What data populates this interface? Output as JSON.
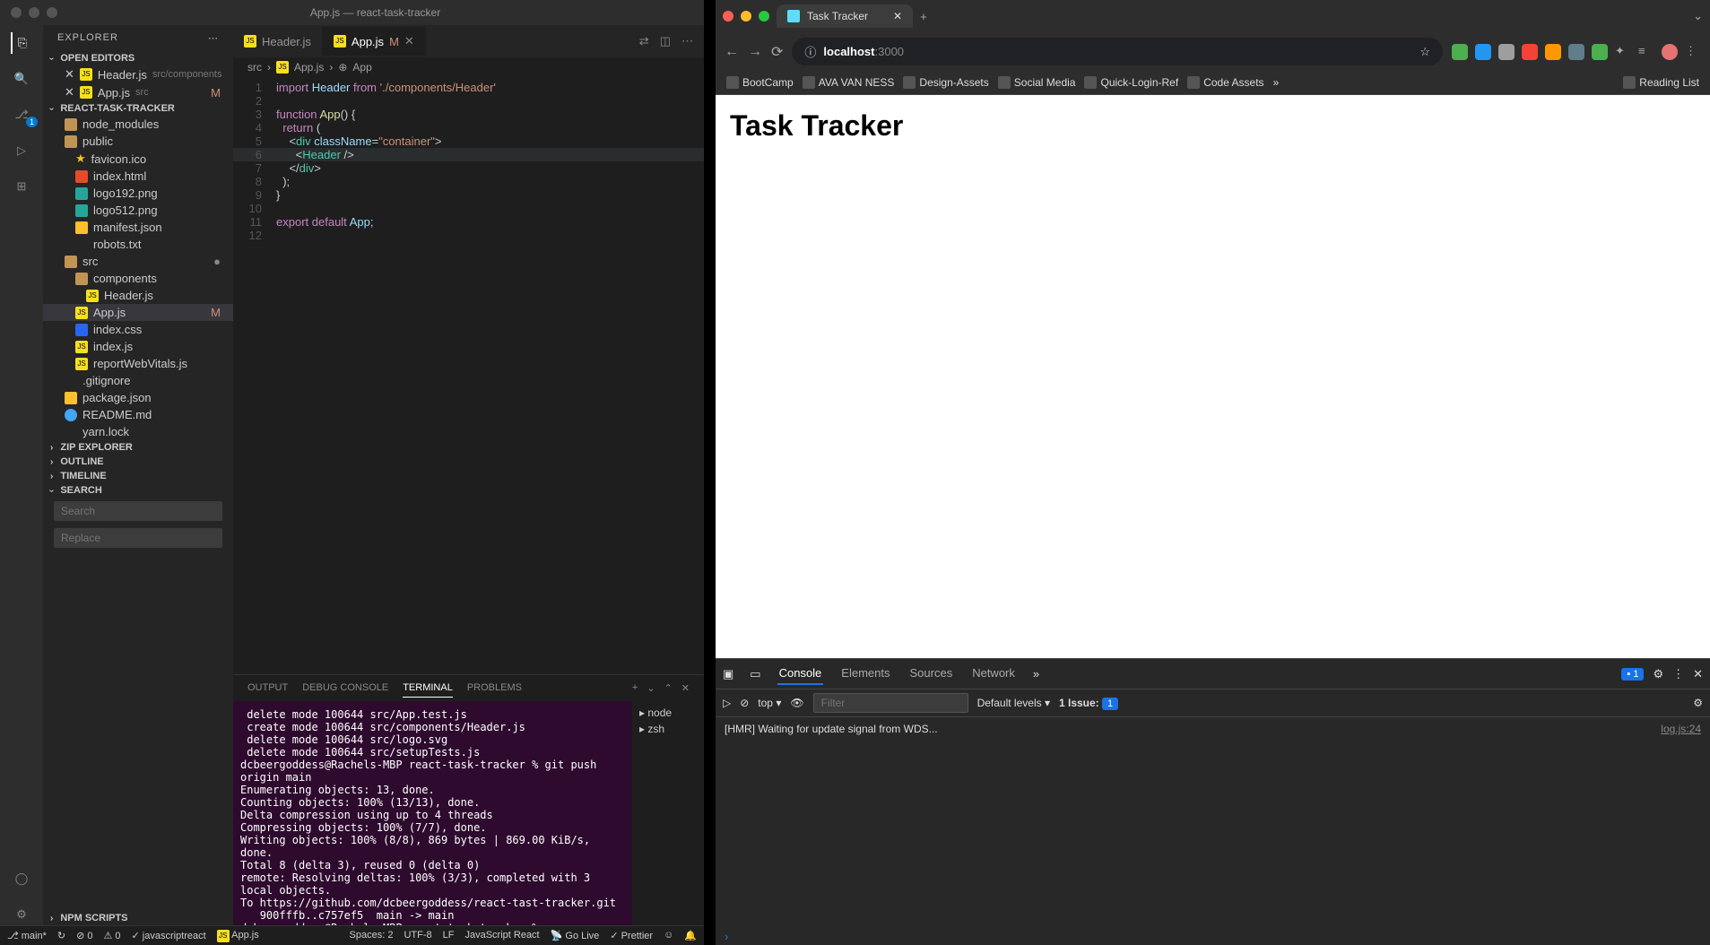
{
  "vscode": {
    "title": "App.js — react-task-tracker",
    "explorer": {
      "title": "EXPLORER",
      "openEditors": "OPEN EDITORS",
      "project": "REACT-TASK-TRACKER",
      "zipExplorer": "ZIP EXPLORER",
      "outline": "OUTLINE",
      "timeline": "TIMELINE",
      "search": "SEARCH",
      "npmScripts": "NPM SCRIPTS",
      "searchPlaceholder": "Search",
      "replacePlaceholder": "Replace",
      "openFiles": [
        {
          "name": "Header.js",
          "path": "src/components"
        },
        {
          "name": "App.js",
          "path": "src",
          "modified": "M"
        }
      ],
      "tree": [
        {
          "name": "node_modules",
          "icon": "folder"
        },
        {
          "name": "public",
          "icon": "folder"
        },
        {
          "name": "favicon.ico",
          "icon": "star",
          "indent": 1
        },
        {
          "name": "index.html",
          "icon": "html",
          "indent": 1
        },
        {
          "name": "logo192.png",
          "icon": "img",
          "indent": 1
        },
        {
          "name": "logo512.png",
          "icon": "img",
          "indent": 1
        },
        {
          "name": "manifest.json",
          "icon": "json",
          "indent": 1
        },
        {
          "name": "robots.txt",
          "icon": "txt",
          "indent": 1
        },
        {
          "name": "src",
          "icon": "folder",
          "dot": true
        },
        {
          "name": "components",
          "icon": "folder",
          "indent": 1
        },
        {
          "name": "Header.js",
          "icon": "js",
          "indent": 2
        },
        {
          "name": "App.js",
          "icon": "js",
          "indent": 1,
          "modified": "M",
          "active": true
        },
        {
          "name": "index.css",
          "icon": "css",
          "indent": 1
        },
        {
          "name": "index.js",
          "icon": "js",
          "indent": 1
        },
        {
          "name": "reportWebVitals.js",
          "icon": "js",
          "indent": 1
        },
        {
          "name": ".gitignore",
          "icon": "git"
        },
        {
          "name": "package.json",
          "icon": "json"
        },
        {
          "name": "README.md",
          "icon": "md"
        },
        {
          "name": "yarn.lock",
          "icon": "lock"
        }
      ]
    },
    "tabs": [
      {
        "name": "Header.js",
        "active": false
      },
      {
        "name": "App.js",
        "active": true,
        "modified": "M"
      }
    ],
    "breadcrumb": [
      "src",
      "App.js",
      "App"
    ],
    "code": {
      "lines": [
        {
          "n": 1,
          "html": "<span class='kw'>import</span> <span class='attr'>Header</span> <span class='kw'>from</span> <span class='str'>'./components/Header'</span>"
        },
        {
          "n": 2,
          "html": ""
        },
        {
          "n": 3,
          "html": "<span class='kw'>function</span> <span class='fn'>App</span>() {"
        },
        {
          "n": 4,
          "html": "  <span class='kw'>return</span> ("
        },
        {
          "n": 5,
          "html": "    &lt;<span class='tag'>div</span> <span class='attr'>className</span>=<span class='str'>\"container\"</span>&gt;"
        },
        {
          "n": 6,
          "html": "      &lt;<span class='cls'>Header</span> /&gt;",
          "current": true
        },
        {
          "n": 7,
          "html": "    &lt;/<span class='tag'>div</span>&gt;"
        },
        {
          "n": 8,
          "html": "  );"
        },
        {
          "n": 9,
          "html": "}"
        },
        {
          "n": 10,
          "html": ""
        },
        {
          "n": 11,
          "html": "<span class='kw'>export</span> <span class='kw'>default</span> <span class='attr'>App</span>;"
        },
        {
          "n": 12,
          "html": ""
        }
      ]
    },
    "panel": {
      "tabs": [
        "OUTPUT",
        "DEBUG CONSOLE",
        "TERMINAL",
        "PROBLEMS"
      ],
      "active": "TERMINAL",
      "shells": [
        "node",
        "zsh"
      ],
      "terminal": " delete mode 100644 src/App.test.js\n create mode 100644 src/components/Header.js\n delete mode 100644 src/logo.svg\n delete mode 100644 src/setupTests.js\ndcbeergoddess@Rachels-MBP react-task-tracker % git push origin main\nEnumerating objects: 13, done.\nCounting objects: 100% (13/13), done.\nDelta compression using up to 4 threads\nCompressing objects: 100% (7/7), done.\nWriting objects: 100% (8/8), 869 bytes | 869.00 KiB/s, done.\nTotal 8 (delta 3), reused 0 (delta 0)\nremote: Resolving deltas: 100% (3/3), completed with 3 local objects.\nTo https://github.com/dcbeergoddess/react-tast-tracker.git\n   900fffb..c757ef5  main -> main\ndcbeergoddess@Rachels-MBP react-task-tracker % ▯"
    },
    "status": {
      "branch": "main*",
      "sync": "↻",
      "errors": "⊘ 0",
      "warnings": "⚠ 0",
      "lint": "✓ javascriptreact",
      "file": "App.js",
      "spaces": "Spaces: 2",
      "encoding": "UTF-8",
      "eol": "LF",
      "lang": "JavaScript React",
      "goLive": "Go Live",
      "prettier": "Prettier"
    }
  },
  "browser": {
    "tab": {
      "title": "Task Tracker"
    },
    "url": {
      "host": "localhost",
      "port": ":3000"
    },
    "bookmarks": [
      "BootCamp",
      "AVA VAN NESS",
      "Design-Assets",
      "Social Media",
      "Quick-Login-Ref",
      "Code Assets",
      "Reading List"
    ],
    "page": {
      "heading": "Task Tracker"
    },
    "devtools": {
      "tabs": [
        "Console",
        "Elements",
        "Sources",
        "Network"
      ],
      "active": "Console",
      "issuesBadge": "1",
      "context": "top",
      "filterPlaceholder": "Filter",
      "levels": "Default levels",
      "issues": "1 Issue:",
      "issuesCount": "1",
      "log": {
        "msg": "[HMR] Waiting for update signal from WDS...",
        "src": "log.js:24"
      }
    }
  }
}
